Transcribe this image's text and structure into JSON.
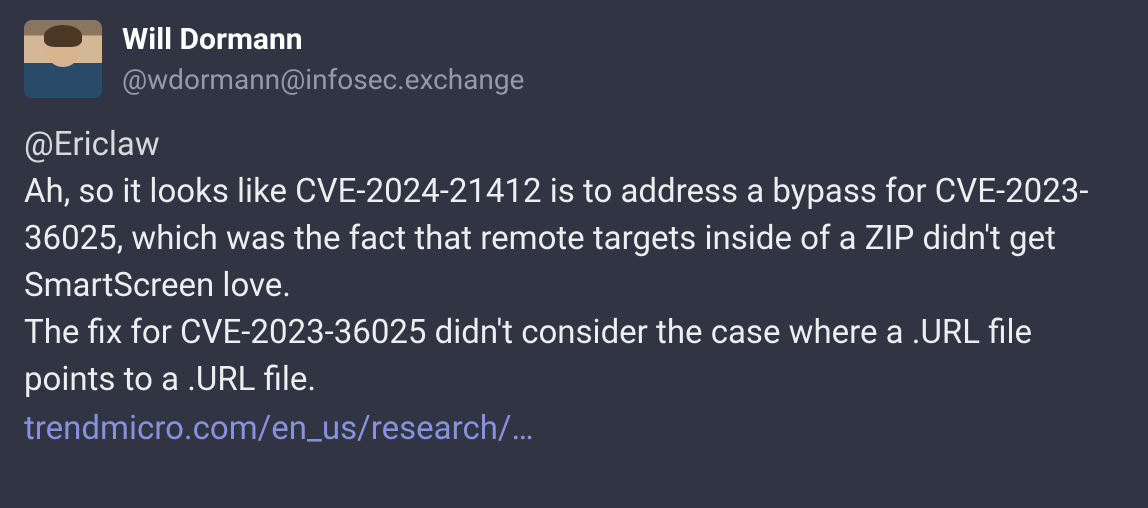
{
  "post": {
    "author": {
      "display_name": "Will Dormann",
      "handle": "@wdormann@infosec.exchange"
    },
    "mention": "@Ericlaw",
    "body_line1": "Ah, so it looks like CVE-2024-21412 is to address a bypass for CVE-2023-36025, which was the fact that remote targets inside of a ZIP didn't get SmartScreen love.",
    "body_line2": "The fix for CVE-2023-36025 didn't consider the case where a .URL file points to a .URL file.",
    "link_text": "trendmicro.com/en_us/research/…"
  }
}
